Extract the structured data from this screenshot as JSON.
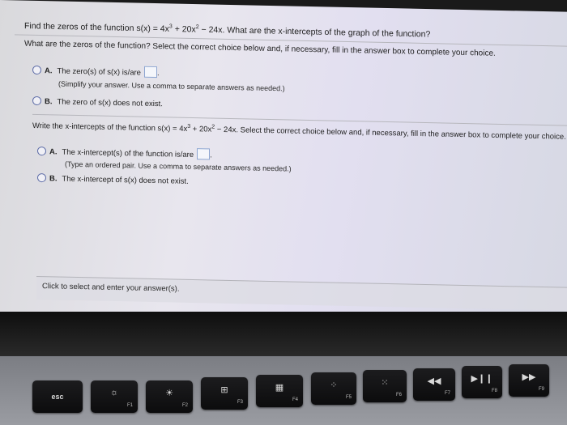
{
  "question": {
    "line1_pre": "Find the zeros of the function s(x) = 4x",
    "line1_mid": " + 20x",
    "line1_post": " − 24x. What are the x-intercepts of the graph of the function?",
    "exp3": "3",
    "exp2": "2",
    "line2": "What are the zeros of the function? Select the correct choice below and, if necessary, fill in the answer box to complete your choice."
  },
  "zeros": {
    "a_letter": "A.",
    "a_text": "The zero(s) of s(x) is/are",
    "a_period": ".",
    "a_hint": "(Simplify your answer. Use a comma to separate answers as needed.)",
    "b_letter": "B.",
    "b_text": "The zero of s(x) does not exist."
  },
  "intercepts_question": {
    "pre": "Write the x-intercepts of the function s(x) = 4x",
    "mid": " + 20x",
    "post": " − 24x. Select the correct choice below and, if necessary, fill in the answer box to complete your choice."
  },
  "intercepts": {
    "a_letter": "A.",
    "a_text": "The x-intercept(s) of the function is/are",
    "a_period": ".",
    "a_hint": "(Type an ordered pair. Use a comma to separate answers as needed.)",
    "b_letter": "B.",
    "b_text": "The x-intercept of s(x) does not exist."
  },
  "footer": "Click to select and enter your answer(s).",
  "keys": [
    {
      "name": "esc",
      "main": "esc",
      "fn": ""
    },
    {
      "name": "f1",
      "main": "☼",
      "fn": "F1"
    },
    {
      "name": "f2",
      "main": "☀",
      "fn": "F2"
    },
    {
      "name": "f3",
      "main": "⊞",
      "fn": "F3"
    },
    {
      "name": "f4",
      "main": "▦",
      "fn": "F4"
    },
    {
      "name": "f5",
      "main": "⁘",
      "fn": "F5"
    },
    {
      "name": "f6",
      "main": "⁙",
      "fn": "F6"
    },
    {
      "name": "f7",
      "main": "◀◀",
      "fn": "F7"
    },
    {
      "name": "f8",
      "main": "▶❙❙",
      "fn": "F8"
    },
    {
      "name": "f9",
      "main": "▶▶",
      "fn": "F9"
    }
  ]
}
